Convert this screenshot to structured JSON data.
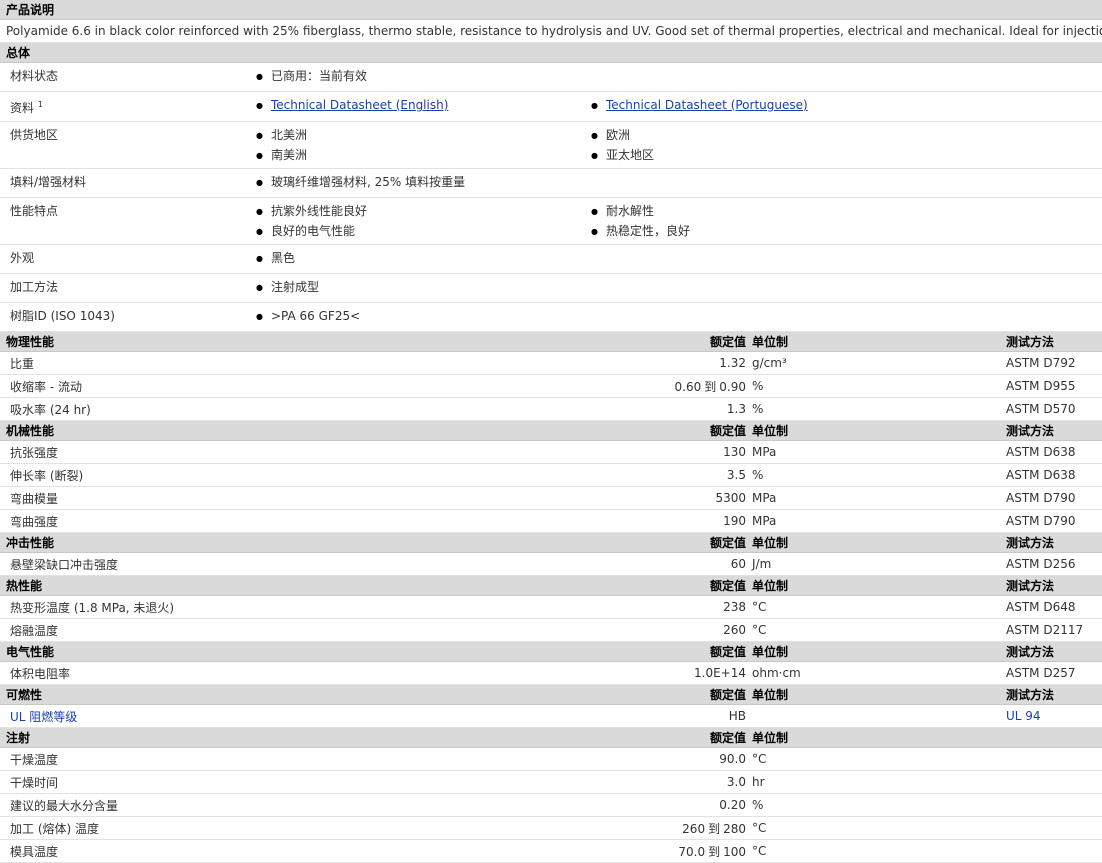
{
  "product_description": {
    "header": "产品说明",
    "text": "Polyamide 6.6 in black color reinforced with 25% fiberglass, thermo stable, resistance to hydrolysis and UV. Good set of thermal properties, electrical and mechanical. Ideal for injection molding."
  },
  "general": {
    "header": "总体",
    "rows": [
      {
        "label": "材料状态",
        "col1": [
          "已商用：当前有效"
        ],
        "col2": []
      },
      {
        "label": "资料",
        "sup": "1",
        "col1": [
          "Technical Datasheet (English)"
        ],
        "col2": [
          "Technical Datasheet (Portuguese)"
        ],
        "links": true
      },
      {
        "label": "供货地区",
        "col1": [
          "北美洲",
          "南美洲"
        ],
        "col2": [
          "欧洲",
          "亚太地区"
        ]
      },
      {
        "label": "填料/增强材料",
        "col1": [
          "玻璃纤维增强材料, 25% 填料按重量"
        ],
        "col2": []
      },
      {
        "label": "性能特点",
        "col1": [
          "抗紫外线性能良好",
          "良好的电气性能"
        ],
        "col2": [
          "耐水解性",
          "热稳定性，良好"
        ]
      },
      {
        "label": "外观",
        "col1": [
          "黑色"
        ],
        "col2": []
      },
      {
        "label": "加工方法",
        "col1": [
          "注射成型"
        ],
        "col2": []
      },
      {
        "label": "树脂ID (ISO 1043)",
        "col1": [
          ">PA 66 GF25<"
        ],
        "col2": []
      }
    ]
  },
  "column_headers": {
    "value": "额定值",
    "unit": "单位制",
    "method": "测试方法"
  },
  "sections": [
    {
      "header": "物理性能",
      "method_header": true,
      "rows": [
        {
          "label": "比重",
          "value": "1.32",
          "unit": "g/cm³",
          "method": "ASTM D792"
        },
        {
          "label": "收缩率 - 流动",
          "value_from": "0.60",
          "value_to": "0.90",
          "unit": "%",
          "method": "ASTM D955"
        },
        {
          "label": "吸水率 (24 hr)",
          "value": "1.3",
          "unit": "%",
          "method": "ASTM D570"
        }
      ]
    },
    {
      "header": "机械性能",
      "method_header": true,
      "rows": [
        {
          "label": "抗张强度",
          "value": "130",
          "unit": "MPa",
          "method": "ASTM D638"
        },
        {
          "label": "伸长率 (断裂)",
          "value": "3.5",
          "unit": "%",
          "method": "ASTM D638"
        },
        {
          "label": "弯曲模量",
          "value": "5300",
          "unit": "MPa",
          "method": "ASTM D790"
        },
        {
          "label": "弯曲强度",
          "value": "190",
          "unit": "MPa",
          "method": "ASTM D790"
        }
      ]
    },
    {
      "header": "冲击性能",
      "method_header": true,
      "rows": [
        {
          "label": "悬壁梁缺口冲击强度",
          "value": "60",
          "unit": "J/m",
          "method": "ASTM D256"
        }
      ]
    },
    {
      "header": "热性能",
      "method_header": true,
      "rows": [
        {
          "label": "热变形温度 (1.8 MPa, 未退火)",
          "value": "238",
          "unit": "°C",
          "method": "ASTM D648"
        },
        {
          "label": "熔融温度",
          "value": "260",
          "unit": "°C",
          "method": "ASTM D2117"
        }
      ]
    },
    {
      "header": "电气性能",
      "method_header": true,
      "rows": [
        {
          "label": "体积电阻率",
          "value": "1.0E+14",
          "unit": "ohm·cm",
          "method": "ASTM D257"
        }
      ]
    },
    {
      "header": "可燃性",
      "method_header": true,
      "rows": [
        {
          "label": "UL 阻燃等级",
          "value": "HB",
          "unit": "",
          "method": "UL 94",
          "link_label": true
        }
      ]
    },
    {
      "header": "注射",
      "method_header": false,
      "rows": [
        {
          "label": "干燥温度",
          "value": "90.0",
          "unit": "°C",
          "method": ""
        },
        {
          "label": "干燥时间",
          "value": "3.0",
          "unit": "hr",
          "method": ""
        },
        {
          "label": "建议的最大水分含量",
          "value": "0.20",
          "unit": "%",
          "method": ""
        },
        {
          "label": "加工 (熔体) 温度",
          "value_from": "260",
          "value_to": "280",
          "unit": "°C",
          "method": ""
        },
        {
          "label": "模具温度",
          "value_from": "70.0",
          "value_to": "100",
          "unit": "°C",
          "method": ""
        }
      ]
    }
  ],
  "range_word": "到"
}
